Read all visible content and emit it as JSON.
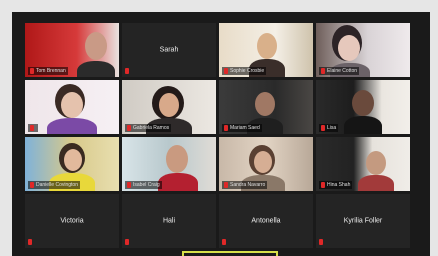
{
  "participants": [
    {
      "name": "Tom Brennan",
      "video": true
    },
    {
      "name": "Sarah",
      "video": false
    },
    {
      "name": "Sophie Crosbie",
      "video": true
    },
    {
      "name": "Elaine Cotton",
      "video": true
    },
    {
      "name": "",
      "video": true
    },
    {
      "name": "Gabriela Ramos",
      "video": true
    },
    {
      "name": "Mariam Saed",
      "video": true
    },
    {
      "name": "Lisa",
      "video": true
    },
    {
      "name": "Danielle Covington",
      "video": true
    },
    {
      "name": "Isabel Craig",
      "video": true
    },
    {
      "name": "Sandra Navarro",
      "video": true
    },
    {
      "name": "Hina Shah",
      "video": true
    },
    {
      "name": "Victoria",
      "video": false
    },
    {
      "name": "Hali",
      "video": false
    },
    {
      "name": "Antonella",
      "video": false
    },
    {
      "name": "Kyrilia Foller",
      "video": false
    }
  ],
  "colors": {
    "gallery_bg": "#1a1a1a",
    "tile_bg": "#242424",
    "mic_muted": "#e02828",
    "active_speaker": "#d7e04a"
  }
}
